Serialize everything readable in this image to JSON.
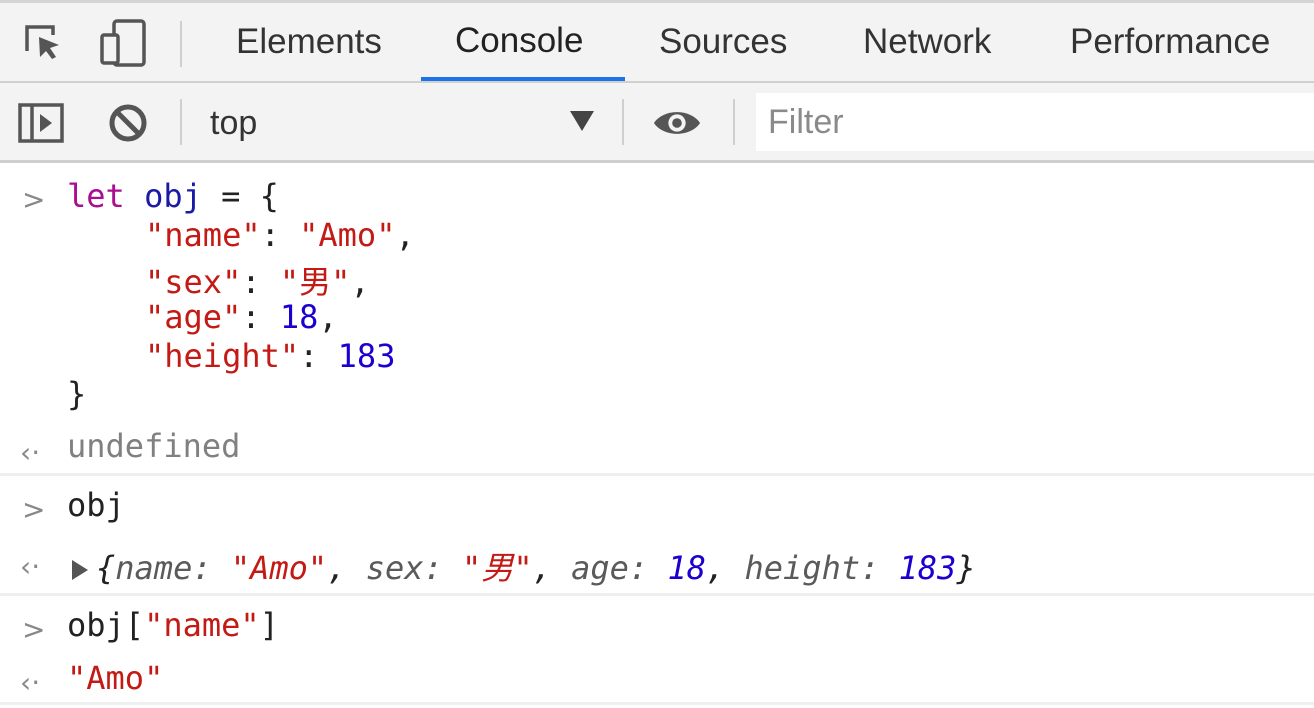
{
  "tabs": [
    {
      "label": "Elements"
    },
    {
      "label": "Console",
      "active": true
    },
    {
      "label": "Sources"
    },
    {
      "label": "Network"
    },
    {
      "label": "Performance"
    }
  ],
  "toolbar": {
    "context": "top",
    "filter_placeholder": "Filter"
  },
  "console": {
    "entry1": {
      "l1_kw": "let",
      "l1_var": "obj",
      "l1_op": " = ",
      "l1_brace": "{",
      "l2_key": "\"name\"",
      "l2_val": "\"Amo\"",
      "l3_key": "\"sex\"",
      "l3_val": "\"男\"",
      "l4_key": "\"age\"",
      "l4_val": "18",
      "l5_key": "\"height\"",
      "l5_val": "183",
      "l6": "}",
      "result": "undefined"
    },
    "entry2": {
      "input": "obj",
      "result": {
        "open": "{",
        "k1": "name",
        "v1": "\"Amo\"",
        "k2": "sex",
        "v2": "\"男\"",
        "k3": "age",
        "v3": "18",
        "k4": "height",
        "v4": "183",
        "close": "}"
      }
    },
    "entry3": {
      "input_obj": "obj",
      "input_open": "[",
      "input_key": "\"name\"",
      "input_close": "]",
      "result": "\"Amo\""
    }
  },
  "colors": {
    "active_tab_underline": "#1a73e8",
    "keyword": "#aa0d91",
    "string": "#c41a16",
    "number": "#1c00cf"
  }
}
